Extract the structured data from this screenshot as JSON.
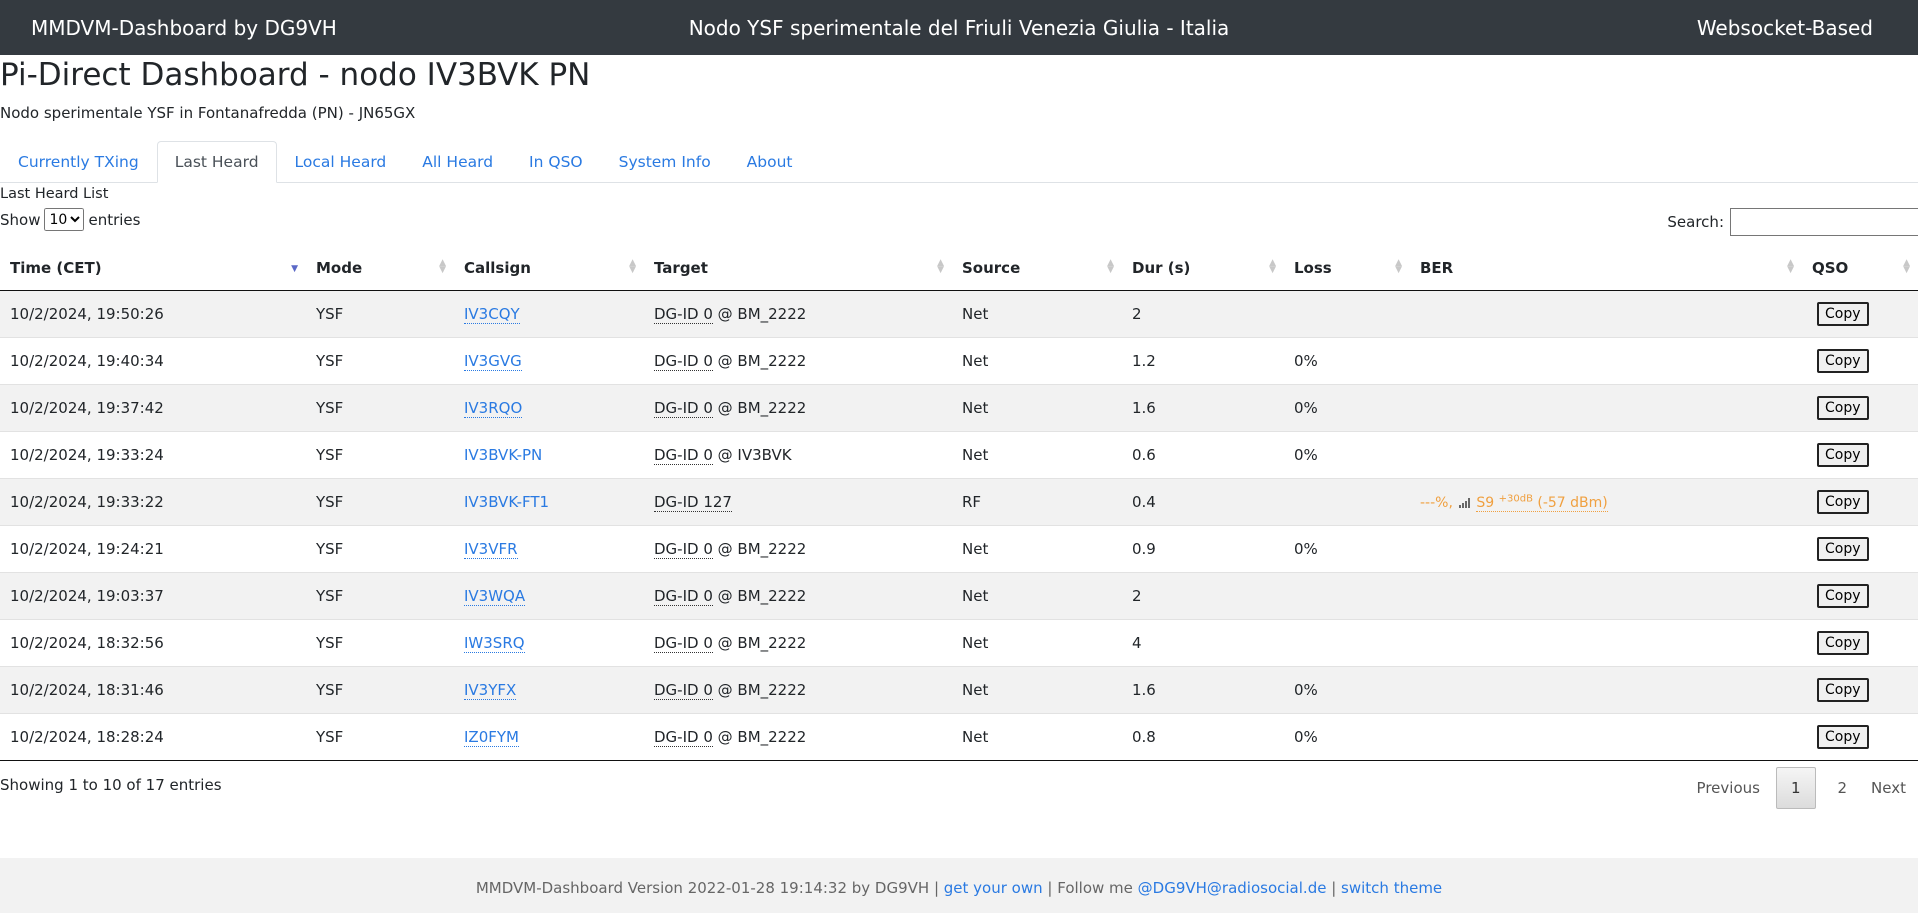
{
  "header": {
    "app_title": "MMDVM-Dashboard by DG9VH",
    "center_title": "Nodo YSF sperimentale del Friuli Venezia Giulia - Italia",
    "right_title": "Websocket-Based"
  },
  "page": {
    "title": "Pi-Direct Dashboard - nodo IV3BVK PN",
    "subtitle": "Nodo sperimentale YSF in Fontanafredda (PN) - JN65GX"
  },
  "tabs": [
    {
      "label": "Currently TXing"
    },
    {
      "label": "Last Heard",
      "active": true
    },
    {
      "label": "Local Heard"
    },
    {
      "label": "All Heard"
    },
    {
      "label": "In QSO"
    },
    {
      "label": "System Info"
    },
    {
      "label": "About"
    }
  ],
  "list": {
    "title": "Last Heard List",
    "show_prefix": "Show",
    "show_value": "10",
    "show_suffix": "entries",
    "search_label": "Search:",
    "search_value": ""
  },
  "table": {
    "columns": [
      "Time (CET)",
      "Mode",
      "Callsign",
      "Target",
      "Source",
      "Dur (s)",
      "Loss",
      "BER",
      "QSO"
    ],
    "rows": [
      {
        "time": "10/2/2024, 19:50:26",
        "mode": "YSF",
        "callsign": "IV3CQY",
        "dgid": "DG-ID 0",
        "target_suffix": " @ BM_2222",
        "source": "Net",
        "dur": "2",
        "loss": "",
        "ber": "",
        "copy": "Copy"
      },
      {
        "time": "10/2/2024, 19:40:34",
        "mode": "YSF",
        "callsign": "IV3GVG",
        "dgid": "DG-ID 0",
        "target_suffix": " @ BM_2222",
        "source": "Net",
        "dur": "1.2",
        "loss": "0%",
        "ber": "",
        "copy": "Copy"
      },
      {
        "time": "10/2/2024, 19:37:42",
        "mode": "YSF",
        "callsign": "IV3RQO",
        "dgid": "DG-ID 0",
        "target_suffix": " @ BM_2222",
        "source": "Net",
        "dur": "1.6",
        "loss": "0%",
        "ber": "",
        "copy": "Copy"
      },
      {
        "time": "10/2/2024, 19:33:24",
        "mode": "YSF",
        "callsign": "IV3BVK-PN",
        "dgid": "DG-ID 0",
        "target_suffix": " @ IV3BVK",
        "source": "Net",
        "dur": "0.6",
        "loss": "0%",
        "ber": "",
        "copy": "Copy"
      },
      {
        "time": "10/2/2024, 19:33:22",
        "mode": "YSF",
        "callsign": "IV3BVK-FT1",
        "dgid": "DG-ID 127",
        "target_suffix": "",
        "source": "RF",
        "dur": "0.4",
        "loss": "",
        "ber": "---%,",
        "signal": "S9",
        "signal_sup": "+30dB",
        "signal_dbm": "(-57 dBm)",
        "copy": "Copy"
      },
      {
        "time": "10/2/2024, 19:24:21",
        "mode": "YSF",
        "callsign": "IV3VFR",
        "dgid": "DG-ID 0",
        "target_suffix": " @ BM_2222",
        "source": "Net",
        "dur": "0.9",
        "loss": "0%",
        "ber": "",
        "copy": "Copy"
      },
      {
        "time": "10/2/2024, 19:03:37",
        "mode": "YSF",
        "callsign": "IV3WQA",
        "dgid": "DG-ID 0",
        "target_suffix": " @ BM_2222",
        "source": "Net",
        "dur": "2",
        "loss": "",
        "ber": "",
        "copy": "Copy"
      },
      {
        "time": "10/2/2024, 18:32:56",
        "mode": "YSF",
        "callsign": "IW3SRQ",
        "dgid": "DG-ID 0",
        "target_suffix": " @ BM_2222",
        "source": "Net",
        "dur": "4",
        "loss": "",
        "ber": "",
        "copy": "Copy"
      },
      {
        "time": "10/2/2024, 18:31:46",
        "mode": "YSF",
        "callsign": "IV3YFX",
        "dgid": "DG-ID 0",
        "target_suffix": " @ BM_2222",
        "source": "Net",
        "dur": "1.6",
        "loss": "0%",
        "ber": "",
        "copy": "Copy"
      },
      {
        "time": "10/2/2024, 18:28:24",
        "mode": "YSF",
        "callsign": "IZ0FYM",
        "dgid": "DG-ID 0",
        "target_suffix": " @ BM_2222",
        "source": "Net",
        "dur": "0.8",
        "loss": "0%",
        "ber": "",
        "copy": "Copy"
      }
    ]
  },
  "pagination": {
    "info": "Showing 1 to 10 of 17 entries",
    "previous": "Previous",
    "pages": [
      "1",
      "2"
    ],
    "current": "1",
    "next": "Next"
  },
  "footer": {
    "version_text": "MMDVM-Dashboard Version 2022-01-28 19:14:32 by DG9VH | ",
    "get_your_own": "get your own",
    "follow_text": " | Follow me ",
    "follow_link": "@DG9VH@radiosocial.de",
    "sep": " | ",
    "switch_theme": "switch theme"
  },
  "colors": {
    "header_bg": "#343a40",
    "link": "#2a7ae2",
    "ber_orange": "#f0a040",
    "stripe": "#f2f2f2"
  },
  "icons": {
    "signal": "signal-bars-icon",
    "sort": "sort-arrows-icon"
  }
}
